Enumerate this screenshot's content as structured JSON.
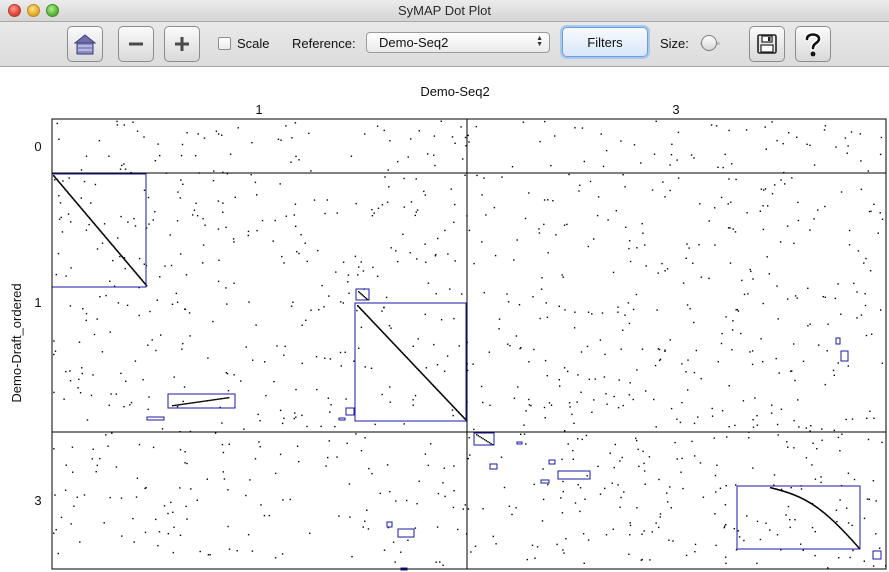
{
  "window": {
    "title": "SyMAP Dot Plot"
  },
  "toolbar": {
    "home_icon": "home-icon",
    "zoom_out_icon": "minus-icon",
    "zoom_in_icon": "plus-icon",
    "scale_label": "Scale",
    "scale_checked": false,
    "reference_label": "Reference:",
    "reference_value": "Demo-Seq2",
    "filters_label": "Filters",
    "size_label": "Size:",
    "save_icon": "save-icon",
    "help_icon": "help-icon"
  },
  "plot": {
    "x_genome": "Demo-Seq2",
    "y_genome": "Demo-Draft_ordered",
    "x_chromosomes": [
      "1",
      "3"
    ],
    "y_chromosomes": [
      "0",
      "1",
      "3"
    ],
    "colors": {
      "border": "#000000",
      "block": "#1a1aa8",
      "dot": "#000000"
    }
  }
}
